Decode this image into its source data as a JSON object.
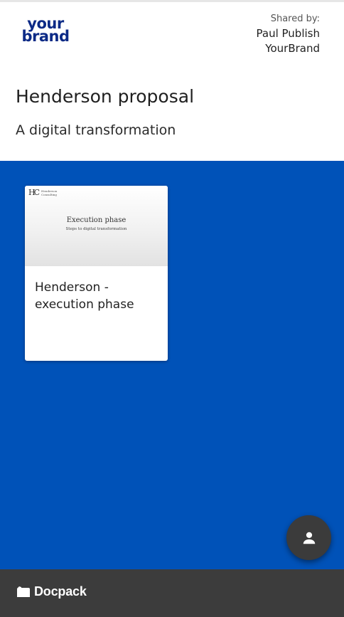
{
  "brand": {
    "logo_line1": "your",
    "logo_line2": "brand",
    "color": "#0c2a86"
  },
  "shared": {
    "label": "Shared by:",
    "name": "Paul Publish",
    "org": "YourBrand"
  },
  "page": {
    "title": "Henderson proposal",
    "subtitle": "A digital transformation"
  },
  "colors": {
    "content_bg": "#0052b8",
    "footer_bg": "#3c3c3c",
    "fab_bg": "#3b3b3b"
  },
  "documents": [
    {
      "title": "Henderson - execution phase",
      "thumbnail": {
        "logo_mark": "HC",
        "logo_org_line1": "Henderson",
        "logo_org_line2": "Consulting",
        "title": "Execution phase",
        "subtitle": "Steps to digital transformation"
      }
    }
  ],
  "fab": {
    "icon": "person-icon"
  },
  "footer": {
    "product_name": "Docpack",
    "icon": "docpack-logo-icon"
  }
}
